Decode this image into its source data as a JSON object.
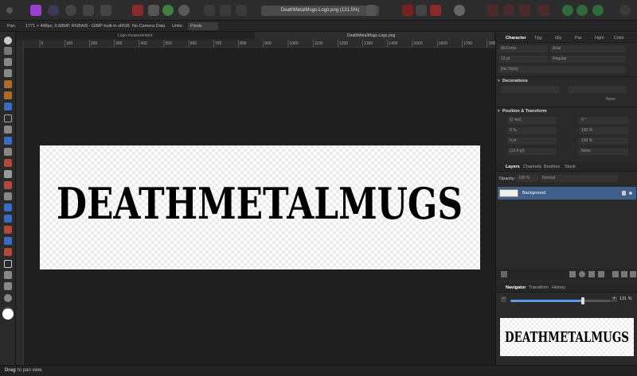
{
  "window": {
    "title": "DeathMetalMugs-Logo.png (131.5%)"
  },
  "context_bar": {
    "tool": "Pan",
    "image_info": "1771 × 498px, 0.88MP, RGBA/8 - GIMP built-in sRGB",
    "camera": "No Camera Data",
    "units_label": "Units:",
    "units_value": "Pixels"
  },
  "doc_tabs": {
    "left": "Logo-measurement",
    "right": "DeathMetalMugs-Logo.png"
  },
  "ruler": {
    "ticks": [
      "0",
      "100",
      "200",
      "300",
      "400",
      "500",
      "600",
      "700",
      "800",
      "900",
      "1000",
      "1100",
      "1200",
      "1300",
      "1400",
      "1500",
      "1600",
      "1700",
      "1800"
    ]
  },
  "artwork": {
    "logo_text": "DEATHMETALMUGS",
    "logo_color": "#000000"
  },
  "status": {
    "hint_bold": "Drag",
    "hint_rest": "to pan view."
  },
  "character_panel": {
    "tabs": [
      "Character",
      "Tpg",
      "Gly",
      "Par",
      "Hgm",
      "Color"
    ],
    "font_collection": "All Fonts",
    "font_family": "Arial",
    "font_size": "12 pt",
    "font_weight": "Regular",
    "style": "[No Style]",
    "decorations_title": "Decorations",
    "decorations_value": "None",
    "position_title": "Position & Transform",
    "kerning": "(0 %o)",
    "rotate": "0 °",
    "tracking": "0 ‰",
    "vscale": "100 %",
    "baseline": "0 pt",
    "hscale": "100 %",
    "leading": "(12.4 pt)",
    "shear": "None"
  },
  "layers_panel": {
    "tabs": [
      "Layers",
      "Channels",
      "Brushes",
      "Stock"
    ],
    "opacity_label": "Opacity:",
    "opacity_value": "100 %",
    "blend_mode": "Normal",
    "layer_name": "Background"
  },
  "navigator_panel": {
    "tabs": [
      "Navigator",
      "Transform",
      "History"
    ],
    "zoom_value": "131 %",
    "zoom_fraction": 0.72
  },
  "colors": {
    "accent": "#3d5f8a",
    "slider": "#5a9ae8"
  }
}
